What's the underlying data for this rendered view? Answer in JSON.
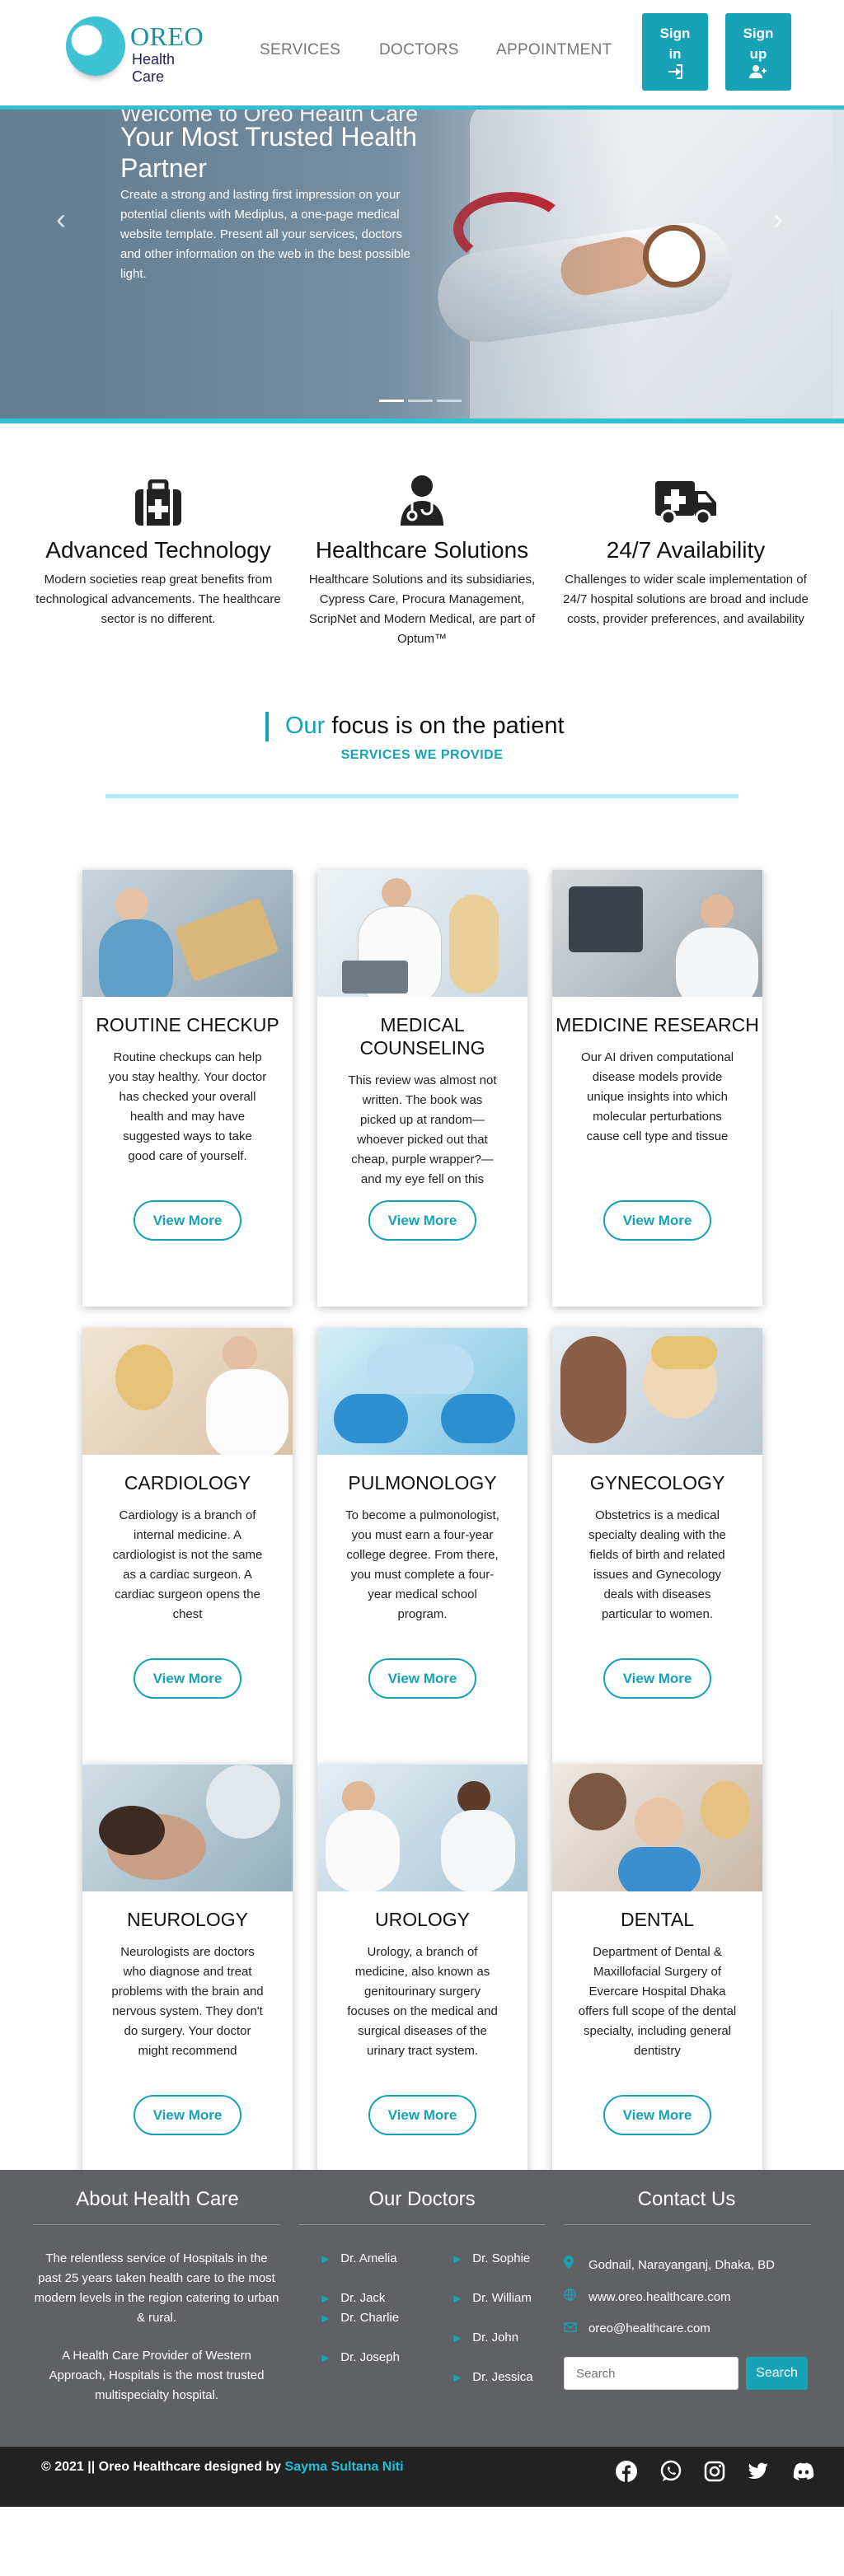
{
  "nav": {
    "logo_name": "OREO",
    "logo_sub": "Health Care",
    "links": [
      "SERVICES",
      "DOCTORS",
      "APPOINTMENT"
    ],
    "signin_label": "Sign in",
    "signup_label": "Sign up"
  },
  "hero": {
    "kicker": "Welcome to Oreo Health Care",
    "title": "Your Most Trusted Health Partner",
    "text": "Create a strong and lasting first impression on your potential clients with Mediplus, a one-page medical website template. Present all your services, doctors and other information on the web in the best possible light.",
    "prev": "‹",
    "next": "›"
  },
  "features": [
    {
      "icon": "medical-kit-icon",
      "title": "Advanced Technology",
      "text": "Modern societies reap great benefits from technological advancements. The healthcare sector is no different."
    },
    {
      "icon": "doctor-icon",
      "title": "Healthcare Solutions",
      "text": "Healthcare Solutions and its subsidiaries, Cypress Care, Procura Management, ScripNet and Modern Medical, are part of Optum™"
    },
    {
      "icon": "ambulance-icon",
      "title": "24/7 Availability",
      "text": "Challenges to wider scale implementation of 24/7 hospital solutions are broad and include costs, provider preferences, and availability"
    }
  ],
  "focus": {
    "title_accent": "Our",
    "title_rest": " focus is on the patient",
    "subtitle": "SERVICES WE PROVIDE"
  },
  "services": [
    {
      "title": "ROUTINE CHECKUP",
      "text": "Routine checkups can help you stay healthy. Your doctor has checked your overall health and may have suggested ways to take good care of yourself.",
      "button": "View More"
    },
    {
      "title": "MEDICAL COUNSELING",
      "text": "This review was almost not written. The book was picked up at random—whoever picked out that cheap, purple wrapper?—and my eye fell on this",
      "button": "View More"
    },
    {
      "title": "MEDICINE RESEARCH",
      "text": "Our AI driven computational disease models provide unique insights into which molecular perturbations cause cell type and tissue",
      "button": "View More"
    },
    {
      "title": "CARDIOLOGY",
      "text": "Cardiology is a branch of internal medicine. A cardiologist is not the same as a cardiac surgeon. A cardiac surgeon opens the chest",
      "button": "View More"
    },
    {
      "title": "PULMONOLOGY",
      "text": "To become a pulmonologist, you must earn a four-year college degree. From there, you must complete a four-year medical school program.",
      "button": "View More"
    },
    {
      "title": "GYNECOLOGY",
      "text": "Obstetrics is a medical specialty dealing with the fields of birth and related issues and Gynecology deals with diseases particular to women.",
      "button": "View More"
    },
    {
      "title": "NEUROLOGY",
      "text": "Neurologists are doctors who diagnose and treat problems with the brain and nervous system. They don't do surgery. Your doctor might recommend",
      "button": "View More"
    },
    {
      "title": "UROLOGY",
      "text": "Urology, a branch of medicine, also known as genitourinary surgery focuses on the medical and surgical diseases of the urinary tract system.",
      "button": "View More"
    },
    {
      "title": "DENTAL",
      "text": "Department of Dental & Maxillofacial Surgery of Evercare Hospital Dhaka offers full scope of the dental specialty, including general dentistry",
      "button": "View More"
    }
  ],
  "footer": {
    "about_title": "About Health Care",
    "about_p1": "The relentless service of Hospitals in the past 25 years taken health care to the most modern levels in the region catering to urban & rural.",
    "about_p2": "A Health Care Provider of Western Approach, Hospitals is the most trusted multispecialty hospital.",
    "doctors_title": "Our Doctors",
    "doctors": [
      "Dr. Amelia",
      "Dr. Jack",
      "Dr. Charlie",
      "Dr. Joseph",
      "Dr. Sophie",
      "Dr. William",
      "Dr. John",
      "Dr. Jessica"
    ],
    "contact_title": "Contact Us",
    "address": "Godnail, Narayanganj, Dhaka, BD",
    "website": "www.oreo.healthcare.com",
    "email": "oreo@healthcare.com",
    "search_placeholder": "Search",
    "search_button": "Search",
    "copyright": "© 2021 || Oreo Healthcare designed by ",
    "author": "Sayma Sultana Niti",
    "social": [
      "facebook-icon",
      "whatsapp-icon",
      "instagram-icon",
      "twitter-icon",
      "discord-icon"
    ]
  },
  "colors": {
    "accent": "#17a2b8",
    "footer": "#5f6165",
    "bottom_bar": "#222222"
  }
}
